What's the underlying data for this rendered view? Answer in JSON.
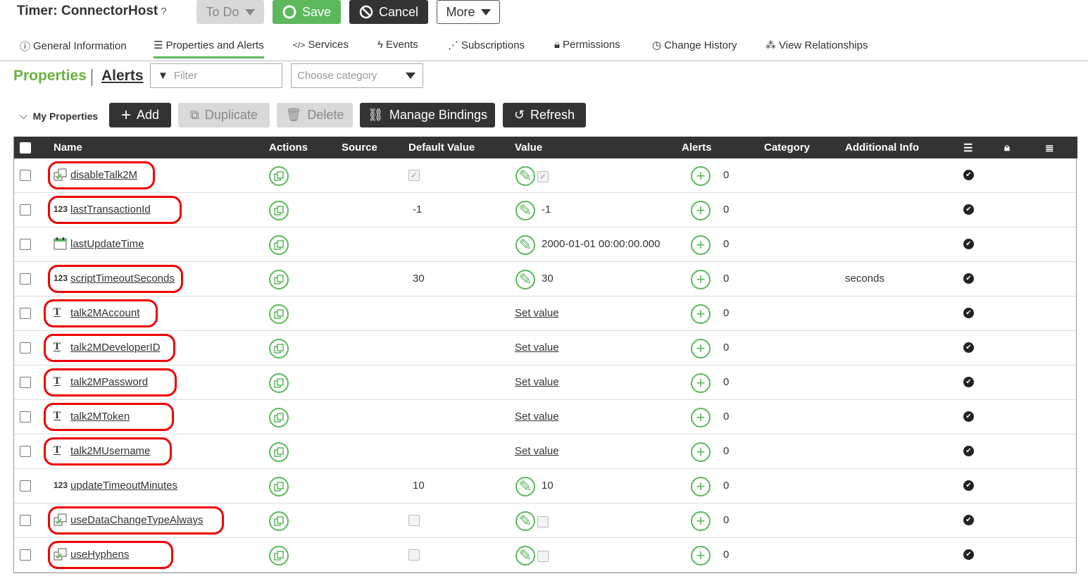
{
  "header": {
    "title": "Timer: ConnectorHost",
    "help_icon": "?",
    "todo_label": "To Do",
    "save_label": "Save",
    "cancel_label": "Cancel",
    "more_label": "More"
  },
  "tabs": [
    {
      "label": "General Information",
      "icon": "info-icon"
    },
    {
      "label": "Properties and Alerts",
      "icon": "list-icon"
    },
    {
      "label": "Services",
      "icon": "code-icon"
    },
    {
      "label": "Events",
      "icon": "bolt-icon"
    },
    {
      "label": "Subscriptions",
      "icon": "rss-icon"
    },
    {
      "label": "Permissions",
      "icon": "lock-icon"
    },
    {
      "label": "Change History",
      "icon": "clock-icon"
    },
    {
      "label": "View Relationships",
      "icon": "network-icon"
    }
  ],
  "subnav": {
    "properties": "Properties",
    "alerts": "Alerts",
    "filter_placeholder": "Filter",
    "category_placeholder": "Choose category"
  },
  "toolbar": {
    "section": "My Properties",
    "add": "Add",
    "duplicate": "Duplicate",
    "delete": "Delete",
    "manage_bindings": "Manage Bindings",
    "refresh": "Refresh"
  },
  "columns": [
    "Name",
    "Actions",
    "Source",
    "Default Value",
    "Value",
    "Alerts",
    "Category",
    "Additional Info"
  ],
  "rows": [
    {
      "type": "boolean",
      "type_label": "",
      "name": "disableTalk2M",
      "default": "",
      "value": "",
      "alerts": "0",
      "info": "",
      "default_checked": true,
      "value_checked": true
    },
    {
      "type": "number",
      "type_label": "123",
      "name": "lastTransactionId",
      "default": "-1",
      "value": "-1",
      "alerts": "0",
      "info": ""
    },
    {
      "type": "datetime",
      "type_label": "",
      "name": "lastUpdateTime",
      "default": "",
      "value": "2000-01-01 00:00:00.000",
      "alerts": "0",
      "info": ""
    },
    {
      "type": "number",
      "type_label": "123",
      "name": "scriptTimeoutSeconds",
      "default": "30",
      "value": "30",
      "alerts": "0",
      "info": "seconds"
    },
    {
      "type": "string",
      "type_label": "T",
      "name": "talk2MAccount",
      "default": "",
      "value": "Set value",
      "alerts": "0",
      "info": ""
    },
    {
      "type": "string",
      "type_label": "T",
      "name": "talk2MDeveloperID",
      "default": "",
      "value": "Set value",
      "alerts": "0",
      "info": ""
    },
    {
      "type": "string",
      "type_label": "T",
      "name": "talk2MPassword",
      "default": "",
      "value": "Set value",
      "alerts": "0",
      "info": ""
    },
    {
      "type": "string",
      "type_label": "T",
      "name": "talk2MToken",
      "default": "",
      "value": "Set value",
      "alerts": "0",
      "info": ""
    },
    {
      "type": "string",
      "type_label": "T",
      "name": "talk2MUsername",
      "default": "",
      "value": "Set value",
      "alerts": "0",
      "info": ""
    },
    {
      "type": "number",
      "type_label": "123",
      "name": "updateTimeoutMinutes",
      "default": "10",
      "value": "10",
      "alerts": "0",
      "info": ""
    },
    {
      "type": "boolean",
      "type_label": "",
      "name": "useDataChangeTypeAlways",
      "default": "",
      "value": "",
      "alerts": "0",
      "info": "",
      "default_checked": false,
      "value_checked": false
    },
    {
      "type": "boolean",
      "type_label": "",
      "name": "useHyphens",
      "default": "",
      "value": "",
      "alerts": "0",
      "info": "",
      "default_checked": false,
      "value_checked": false
    }
  ],
  "colors": {
    "accent": "#5cb85c",
    "dark": "#333333",
    "annotation": "#e00000"
  }
}
